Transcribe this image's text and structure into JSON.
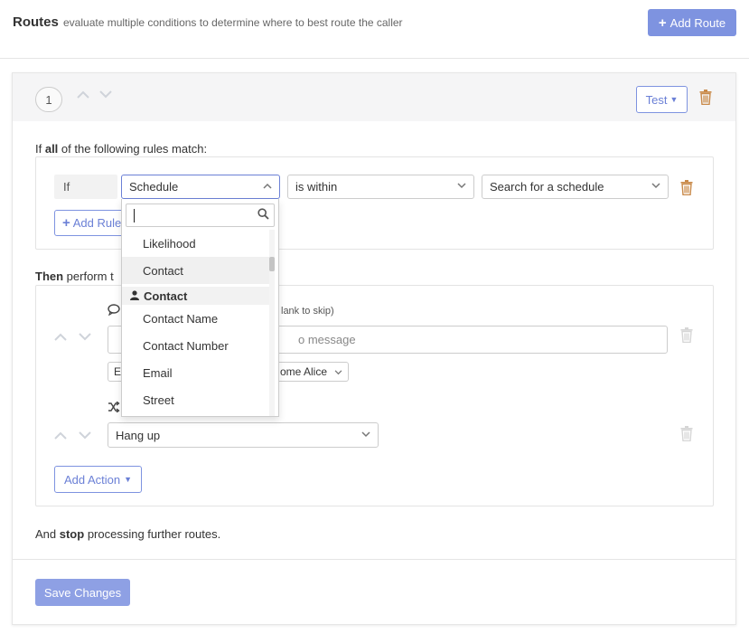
{
  "header": {
    "title": "Routes",
    "subtitle": "evaluate multiple conditions to determine where to best route the caller",
    "add_route_label": "Add Route"
  },
  "route": {
    "number": "1",
    "test_label": "Test",
    "rules_prefix": "If ",
    "rules_bold": "all",
    "rules_suffix": " of the following rules match:",
    "rule": {
      "if_label": "If",
      "field": "Schedule",
      "operator": "is within",
      "value_placeholder": "Search for a schedule"
    },
    "add_rule_label": "Add Rule",
    "then_bold": "Then",
    "then_suffix": " perform t",
    "actions": {
      "skip_hint": "lank to skip)",
      "message_placeholder": "o message",
      "voice_prefix": "E",
      "voice_select": "ome Alice",
      "hangup_select": "Hang up"
    },
    "add_action_label": "Add Action",
    "stop_prefix": "And ",
    "stop_bold": "stop",
    "stop_suffix": " processing further routes.",
    "save_label": "Save Changes"
  },
  "dropdown": {
    "search_value": "",
    "items_top": [
      "Likelihood",
      "Contact"
    ],
    "group_label": "Contact",
    "group_items": [
      "Contact Name",
      "Contact Number",
      "Email",
      "Street"
    ]
  },
  "colors": {
    "accent": "#7e93e0",
    "accent_text": "#6b80d6",
    "trash_active": "#c98a4a",
    "trash_disabled": "#d6d6d6"
  }
}
